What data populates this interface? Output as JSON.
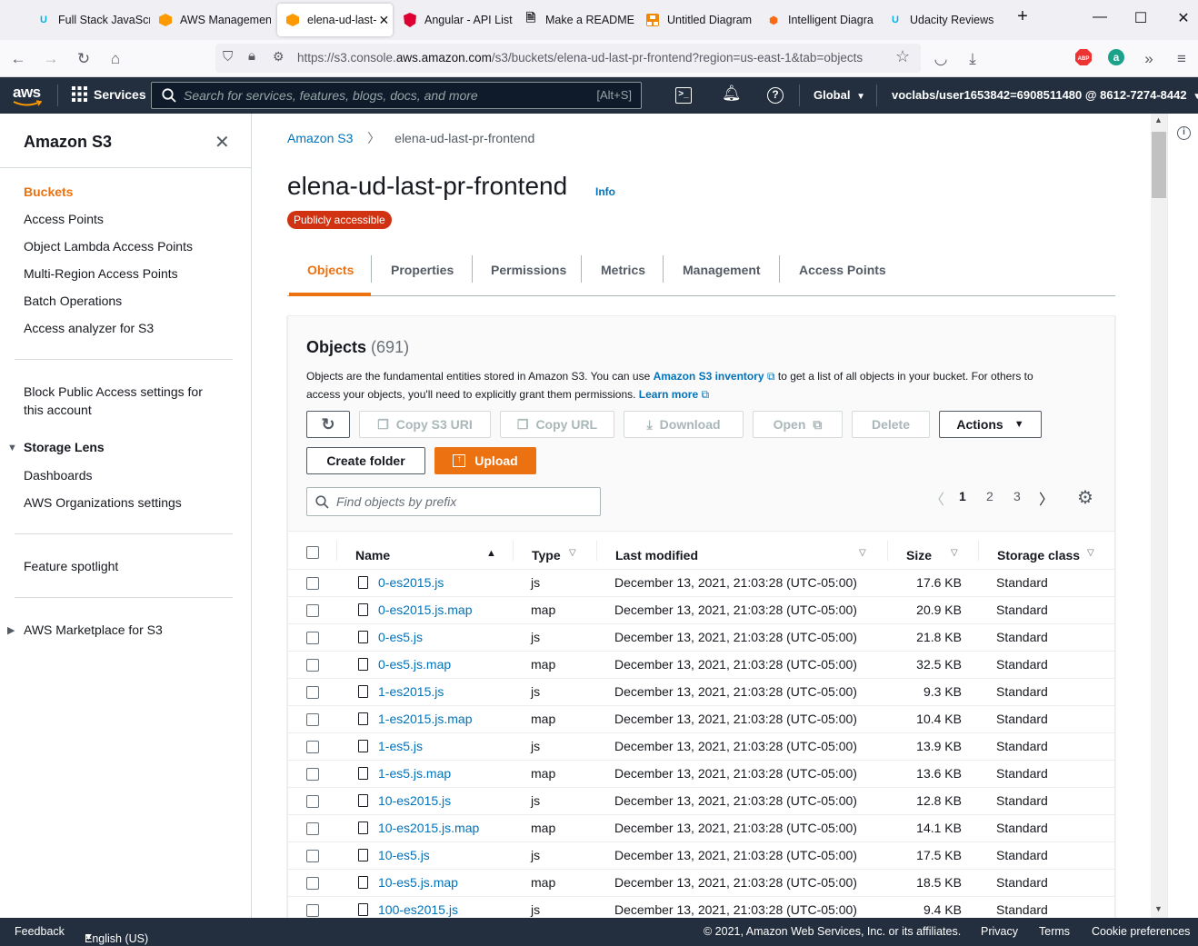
{
  "browser": {
    "tabs": [
      {
        "title": "Full Stack JavaScr",
        "icon": "udacity-icon"
      },
      {
        "title": "AWS Managemen",
        "icon": "aws-cube-icon"
      },
      {
        "title": "elena-ud-last-",
        "icon": "aws-cube-icon",
        "active": true
      },
      {
        "title": "Angular - API List",
        "icon": "angular-icon"
      },
      {
        "title": "Make a README",
        "icon": "document-icon"
      },
      {
        "title": "Untitled Diagram",
        "icon": "drawio-icon"
      },
      {
        "title": "Intelligent Diagra",
        "icon": "lucid-icon"
      },
      {
        "title": "Udacity Reviews",
        "icon": "udacity-icon"
      }
    ],
    "url_prefix": "https://s3.console.",
    "url_domain": "aws.amazon.com",
    "url_rest": "/s3/buckets/elena-ud-last-pr-frontend?region=us-east-1&tab=objects"
  },
  "aws_header": {
    "logo": "aws",
    "services_label": "Services",
    "search_placeholder": "Search for services, features, blogs, docs, and more",
    "search_shortcut": "[Alt+S]",
    "region": "Global",
    "account": "voclabs/user1653842=6908511480 @ 8612-7274-8442"
  },
  "sidebar": {
    "title": "Amazon S3",
    "items": [
      "Buckets",
      "Access Points",
      "Object Lambda Access Points",
      "Multi-Region Access Points",
      "Batch Operations",
      "Access analyzer for S3"
    ],
    "block_public_1": "Block Public Access settings for",
    "block_public_2": "this account",
    "storage_lens": "Storage Lens",
    "storage_lens_items": [
      "Dashboards",
      "AWS Organizations settings"
    ],
    "feature_spotlight": "Feature spotlight",
    "marketplace": "AWS Marketplace for S3"
  },
  "breadcrumb": {
    "root": "Amazon S3",
    "current": "elena-ud-last-pr-frontend"
  },
  "bucket": {
    "name": "elena-ud-last-pr-frontend",
    "info": "Info",
    "badge": "Publicly accessible"
  },
  "tabs": [
    "Objects",
    "Properties",
    "Permissions",
    "Metrics",
    "Management",
    "Access Points"
  ],
  "objects": {
    "title": "Objects",
    "count": "(691)",
    "desc_1": "Objects are the fundamental entities stored in Amazon S3. You can use ",
    "desc_link1": "Amazon S3 inventory",
    "desc_2": " to get a list of all objects in your bucket. For others to",
    "desc_3": "access your objects, you'll need to explicitly grant them permissions. ",
    "desc_link2": "Learn more",
    "buttons": {
      "copy_uri": "Copy S3 URI",
      "copy_url": "Copy URL",
      "download": "Download",
      "open": "Open",
      "delete": "Delete",
      "actions": "Actions",
      "create_folder": "Create folder",
      "upload": "Upload"
    },
    "filter_placeholder": "Find objects by prefix",
    "pages": [
      "1",
      "2",
      "3"
    ],
    "columns": {
      "name": "Name",
      "type": "Type",
      "last_modified": "Last modified",
      "size": "Size",
      "storage_class": "Storage class"
    },
    "rows": [
      {
        "name": "0-es2015.js",
        "type": "js",
        "modified": "December 13, 2021, 21:03:28 (UTC-05:00)",
        "size": "17.6 KB",
        "class": "Standard"
      },
      {
        "name": "0-es2015.js.map",
        "type": "map",
        "modified": "December 13, 2021, 21:03:28 (UTC-05:00)",
        "size": "20.9 KB",
        "class": "Standard"
      },
      {
        "name": "0-es5.js",
        "type": "js",
        "modified": "December 13, 2021, 21:03:28 (UTC-05:00)",
        "size": "21.8 KB",
        "class": "Standard"
      },
      {
        "name": "0-es5.js.map",
        "type": "map",
        "modified": "December 13, 2021, 21:03:28 (UTC-05:00)",
        "size": "32.5 KB",
        "class": "Standard"
      },
      {
        "name": "1-es2015.js",
        "type": "js",
        "modified": "December 13, 2021, 21:03:28 (UTC-05:00)",
        "size": "9.3 KB",
        "class": "Standard"
      },
      {
        "name": "1-es2015.js.map",
        "type": "map",
        "modified": "December 13, 2021, 21:03:28 (UTC-05:00)",
        "size": "10.4 KB",
        "class": "Standard"
      },
      {
        "name": "1-es5.js",
        "type": "js",
        "modified": "December 13, 2021, 21:03:28 (UTC-05:00)",
        "size": "13.9 KB",
        "class": "Standard"
      },
      {
        "name": "1-es5.js.map",
        "type": "map",
        "modified": "December 13, 2021, 21:03:28 (UTC-05:00)",
        "size": "13.6 KB",
        "class": "Standard"
      },
      {
        "name": "10-es2015.js",
        "type": "js",
        "modified": "December 13, 2021, 21:03:28 (UTC-05:00)",
        "size": "12.8 KB",
        "class": "Standard"
      },
      {
        "name": "10-es2015.js.map",
        "type": "map",
        "modified": "December 13, 2021, 21:03:28 (UTC-05:00)",
        "size": "14.1 KB",
        "class": "Standard"
      },
      {
        "name": "10-es5.js",
        "type": "js",
        "modified": "December 13, 2021, 21:03:28 (UTC-05:00)",
        "size": "17.5 KB",
        "class": "Standard"
      },
      {
        "name": "10-es5.js.map",
        "type": "map",
        "modified": "December 13, 2021, 21:03:28 (UTC-05:00)",
        "size": "18.5 KB",
        "class": "Standard"
      },
      {
        "name": "100-es2015.js",
        "type": "js",
        "modified": "December 13, 2021, 21:03:28 (UTC-05:00)",
        "size": "9.4 KB",
        "class": "Standard"
      }
    ]
  },
  "footer": {
    "feedback": "Feedback",
    "language": "English (US)",
    "copyright": "© 2021, Amazon Web Services, Inc. or its affiliates.",
    "privacy": "Privacy",
    "terms": "Terms",
    "cookies": "Cookie preferences"
  },
  "colors": {
    "aws_dark": "#232f3e",
    "orange": "#ec7211",
    "link": "#0073bb",
    "badge_red": "#d13212"
  }
}
